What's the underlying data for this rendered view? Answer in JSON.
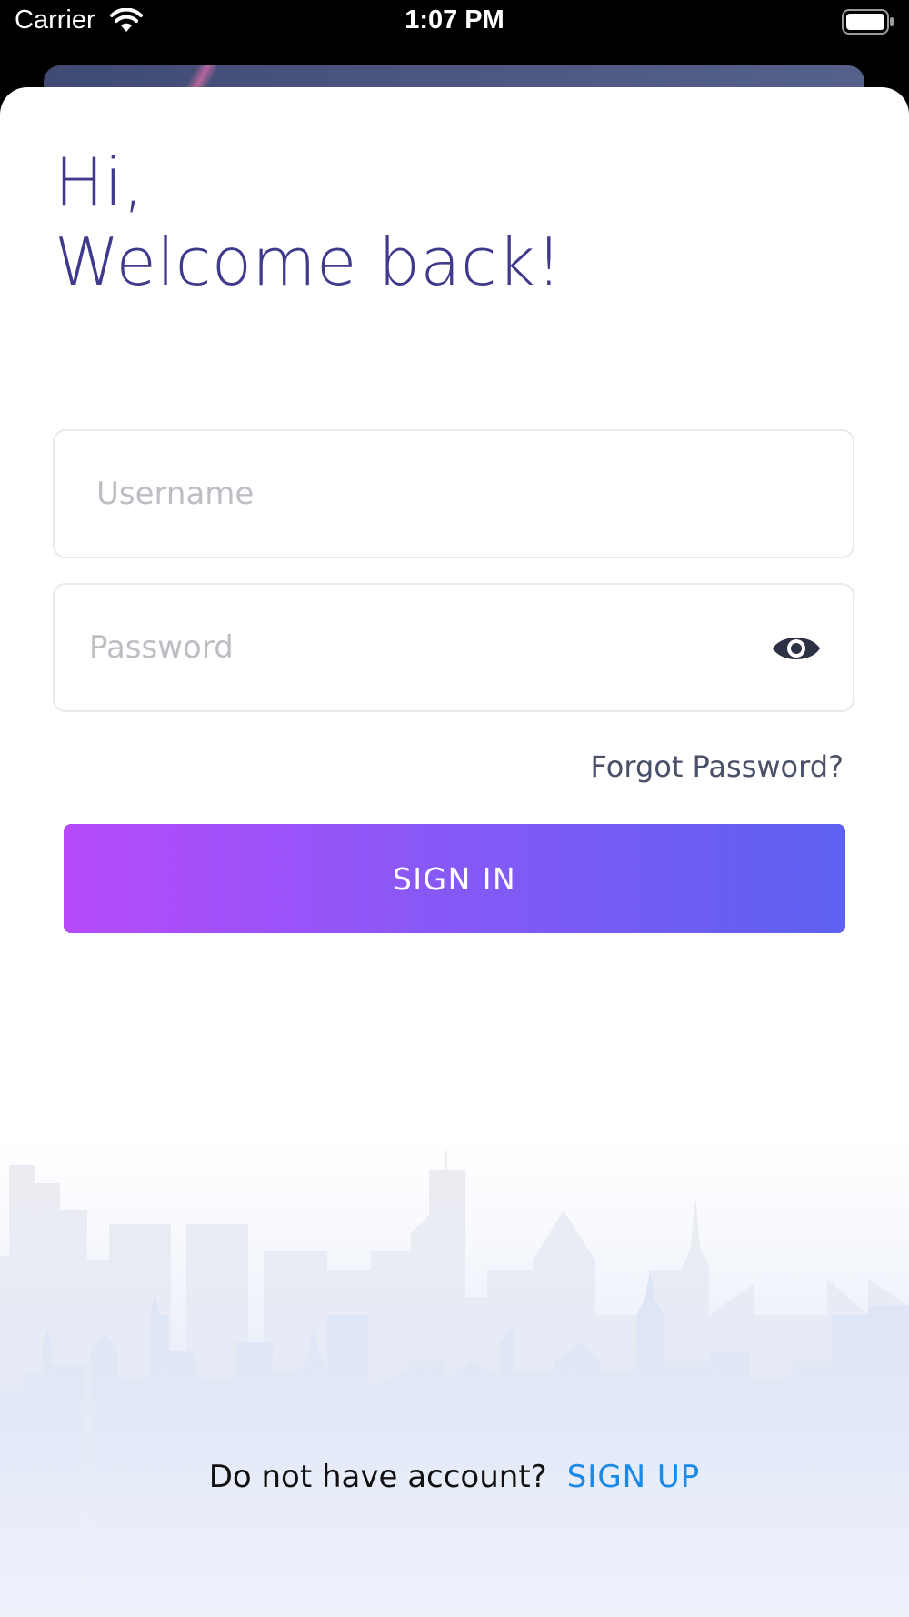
{
  "status_bar": {
    "carrier": "Carrier",
    "time": "1:07 PM"
  },
  "greeting": {
    "line1": "Hi,",
    "line2": "Welcome back!"
  },
  "form": {
    "username_placeholder": "Username",
    "password_placeholder": "Password",
    "forgot_password": "Forgot Password?",
    "sign_in": "SIGN IN"
  },
  "footer": {
    "question": "Do not have account?",
    "sign_up": "SIGN UP"
  },
  "colors": {
    "heading": "#3f3a8c",
    "button_gradient_start": "#b64afb",
    "button_gradient_end": "#5d61f1",
    "link": "#1a8ae6"
  },
  "icons": [
    "wifi-icon",
    "battery-icon",
    "eye-icon"
  ]
}
